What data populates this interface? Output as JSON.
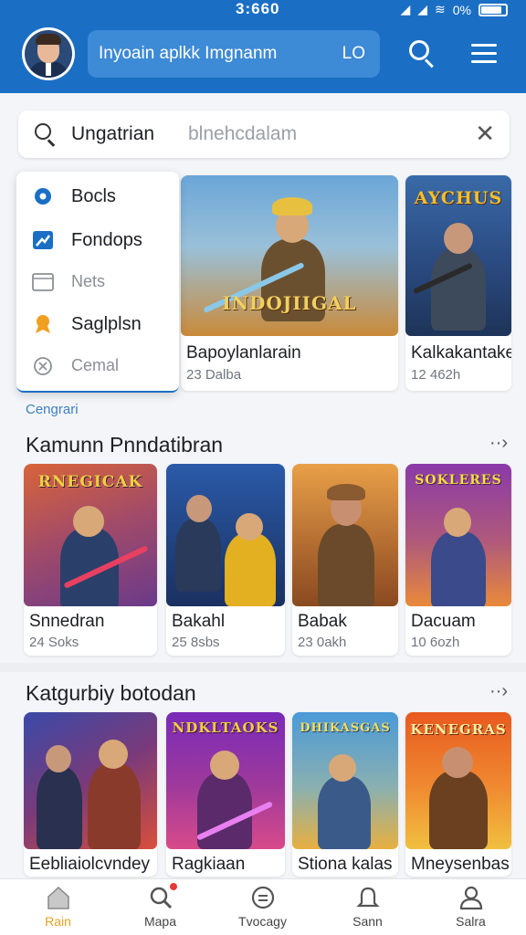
{
  "status_bar": {
    "time": "3:660",
    "battery": "0%"
  },
  "header": {
    "search_text": "Inyoain aplkk Imgnanm",
    "search_go": "LO"
  },
  "search": {
    "value": "Ungatrian",
    "placeholder": "blnehcdalam"
  },
  "menu": {
    "items": [
      {
        "label": "Bocls",
        "icon": "gear-icon",
        "color": "#1a6fc4"
      },
      {
        "label": "Fondops",
        "icon": "chart-icon",
        "color": "#1a6fc4"
      },
      {
        "label": "Nets",
        "icon": "window-icon",
        "color": "#8a8f96"
      },
      {
        "label": "Saglplsn",
        "icon": "award-icon",
        "color": "#f0a020"
      },
      {
        "label": "Cemal",
        "icon": "compass-icon",
        "color": "#8a8f96"
      }
    ]
  },
  "featured": [
    {
      "title": "Bapoylanlarain",
      "sub": "23 Dalba",
      "art_text": "INDOJIIGAL",
      "c1": "#6aa6d8",
      "c2": "#c98a3a",
      "hero": "#6b5030"
    },
    {
      "title": "Kalkakantake",
      "sub": "12 462h",
      "art_text": "AYCHUS",
      "c1": "#3a6aa8",
      "c2": "#1e3458",
      "hero": "#3d4a5c"
    }
  ],
  "small_label": "Cengrari",
  "section1": {
    "title": "Kamunn Pnndatibran",
    "more": "··›",
    "cards": [
      {
        "title": "Snnedran",
        "sub": "24 Soks",
        "art_text": "RNEGICAK",
        "c1": "#d8643a",
        "c2": "#6a3a8a",
        "hero": "#2a3f6a"
      },
      {
        "title": "Bakahl",
        "sub": "25 8sbs",
        "art_text": "",
        "c1": "#2a5aa8",
        "c2": "#1a3060",
        "hero": "#e2b020"
      },
      {
        "title": "Babak",
        "sub": "23 0akh",
        "art_text": "",
        "c1": "#e8a048",
        "c2": "#8a4a20",
        "hero": "#6a4a2a"
      },
      {
        "title": "Dacuam",
        "sub": "10 6ozh",
        "art_text": "SOKLERES",
        "c1": "#8a3aa8",
        "c2": "#e88a3a",
        "hero": "#3a4a8a"
      }
    ]
  },
  "section2": {
    "title": "Katgurbiy botodan",
    "more": "··›",
    "cards": [
      {
        "title": "Eebliaiolcvndey",
        "art_text": "",
        "c1": "#3a4aa8",
        "c2": "#d8503a",
        "hero": "#8a3a2a"
      },
      {
        "title": "Ragkiaan",
        "art_text": "NDKLTAOKS",
        "c1": "#7a2ab8",
        "c2": "#d84a8a",
        "hero": "#5a2a6a"
      },
      {
        "title": "Stiona kalas",
        "art_text": "DHIKASGAS",
        "c1": "#4a9ad8",
        "c2": "#e8b040",
        "hero": "#3a5a8a"
      },
      {
        "title": "Mneysenbas",
        "art_text": "KENEGRAS",
        "c1": "#e85a20",
        "c2": "#f0c040",
        "hero": "#6a4020"
      }
    ]
  },
  "bottom_nav": [
    {
      "label": "Rain",
      "icon": "home-icon",
      "active": true
    },
    {
      "label": "Mapa",
      "icon": "search-icon",
      "active": false
    },
    {
      "label": "Tvocagy",
      "icon": "chat-icon",
      "active": false
    },
    {
      "label": "Sann",
      "icon": "bell-icon",
      "active": false
    },
    {
      "label": "Salra",
      "icon": "profile-icon",
      "active": false
    }
  ],
  "colors": {
    "primary": "#1a6fc4",
    "accent": "#e8a020"
  }
}
